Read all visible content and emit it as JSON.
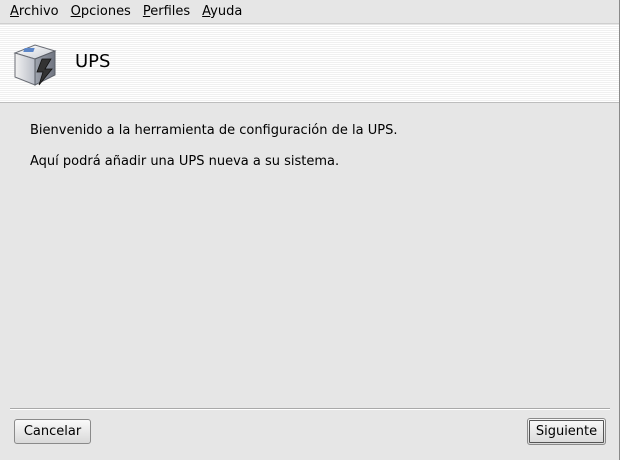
{
  "menubar": {
    "items": [
      {
        "mnemonic": "A",
        "rest": "rchivo"
      },
      {
        "mnemonic": "O",
        "rest": "pciones"
      },
      {
        "mnemonic": "P",
        "rest": "erfiles"
      },
      {
        "mnemonic": "A",
        "rest": "yuda"
      }
    ]
  },
  "header": {
    "title": "UPS",
    "icon": "ups-power-icon"
  },
  "content": {
    "line1": "Bienvenido a la herramienta de configuración de la UPS.",
    "line2": "Aquí podrá añadir una UPS nueva a su sistema."
  },
  "footer": {
    "cancel_label": "Cancelar",
    "next_label": "Siguiente"
  },
  "colors": {
    "background": "#e6e6e6",
    "header_background": "#f4f4f4"
  }
}
